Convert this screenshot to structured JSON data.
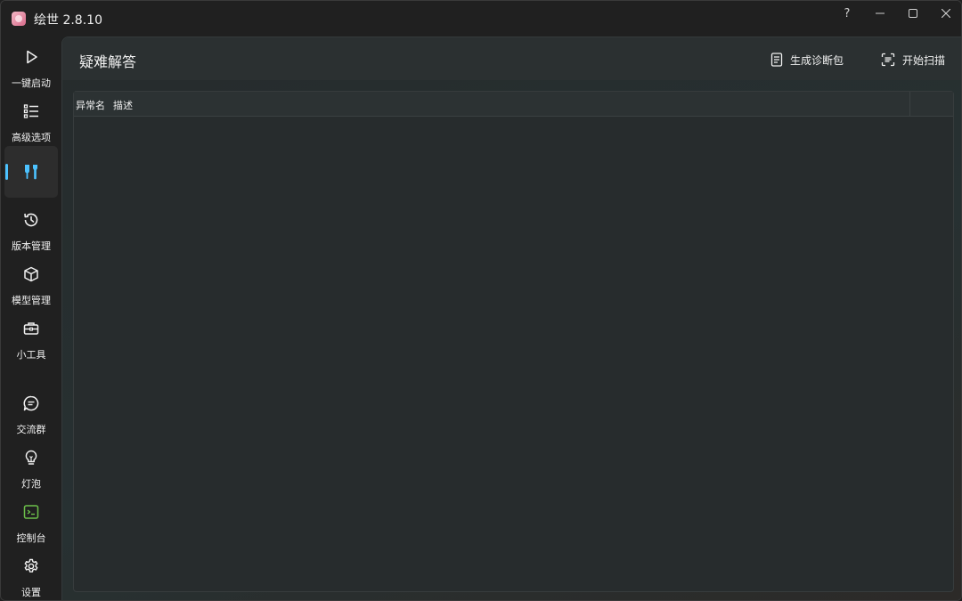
{
  "window": {
    "title": "绘世 2.8.10",
    "controls": {
      "help": "?",
      "minimize": "—",
      "maximize": "☐",
      "close": "✕"
    }
  },
  "sidebar": {
    "items": [
      {
        "label": "一键启动",
        "icon": "play-icon"
      },
      {
        "label": "高级选项",
        "icon": "list-icon"
      },
      {
        "label": "",
        "icon": "tools-icon",
        "active": true
      },
      {
        "label": "版本管理",
        "icon": "history-icon"
      },
      {
        "label": "模型管理",
        "icon": "cube-icon"
      },
      {
        "label": "小工具",
        "icon": "toolbox-icon"
      },
      {
        "label": "交流群",
        "icon": "chat-icon"
      },
      {
        "label": "灯泡",
        "icon": "lightbulb-icon"
      },
      {
        "label": "控制台",
        "icon": "console-icon"
      },
      {
        "label": "设置",
        "icon": "gear-icon"
      }
    ],
    "accent_color": "#4cc2ff",
    "console_icon_color": "#6cc04a"
  },
  "header": {
    "title": "疑难解答",
    "diagnose_label": "生成诊断包",
    "scan_label": "开始扫描"
  },
  "table": {
    "columns": [
      "异常名",
      "描述"
    ],
    "rows": []
  }
}
